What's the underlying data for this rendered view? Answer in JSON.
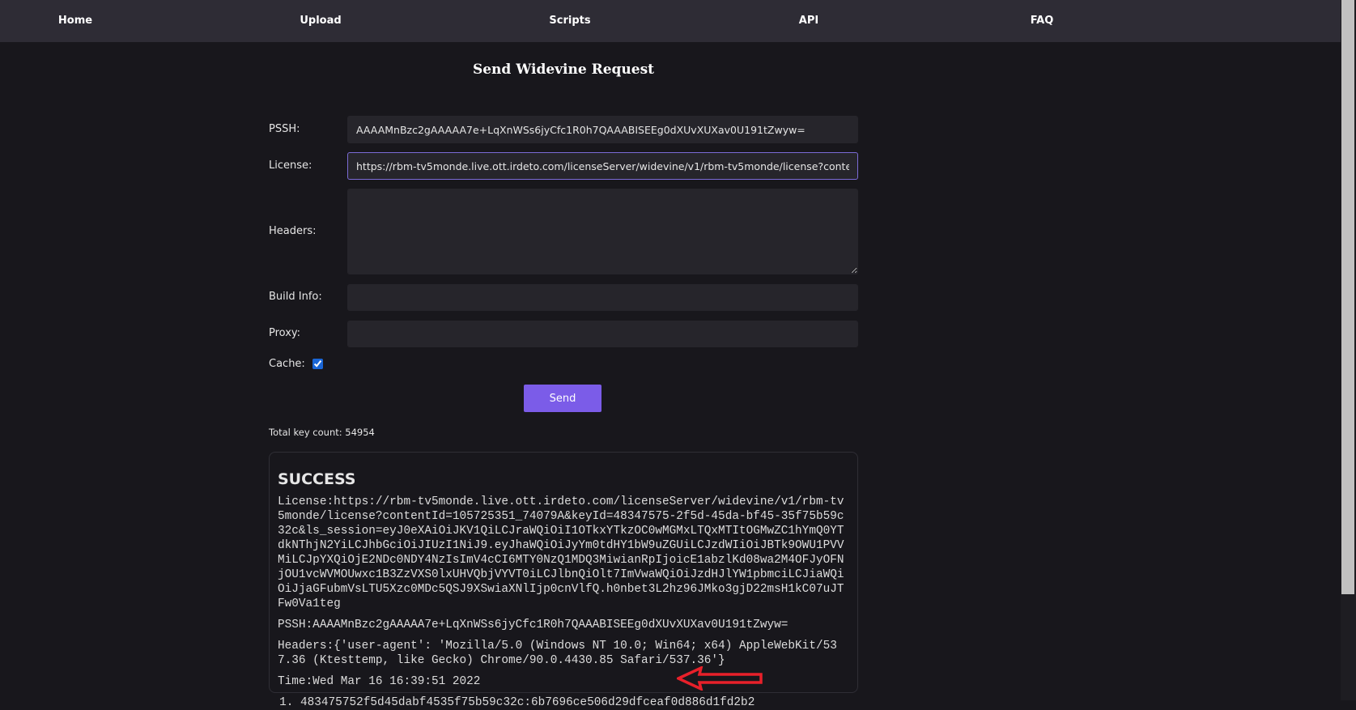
{
  "nav": {
    "items": [
      {
        "label": "Home"
      },
      {
        "label": "Upload"
      },
      {
        "label": "Scripts"
      },
      {
        "label": "API"
      },
      {
        "label": "FAQ"
      }
    ]
  },
  "page_title": "Send Widevine Request",
  "form": {
    "pssh_label": "PSSH:",
    "pssh_value": "AAAAMnBzc2gAAAAA7e+LqXnWSs6jyCfc1R0h7QAAABISEEg0dXUvXUXav0U191tZwyw=",
    "license_label": "License:",
    "license_value": "https://rbm-tv5monde.live.ott.irdeto.com/licenseServer/widevine/v1/rbm-tv5monde/license?contentId=105725351_74079A&keyId=48347575-2f5d-45da-bf45-35f75b59c32c&ls_session=",
    "headers_label": "Headers:",
    "headers_value": "",
    "build_label": "Build Info:",
    "build_value": "",
    "proxy_label": "Proxy:",
    "proxy_value": "",
    "cache_label": "Cache:",
    "cache_checked": true,
    "send_label": "Send"
  },
  "total_key_count": "Total key count: 54954",
  "result": {
    "status": "SUCCESS",
    "license": "License:https://rbm-tv5monde.live.ott.irdeto.com/licenseServer/widevine/v1/rbm-tv5monde/license?contentId=105725351_74079A&keyId=48347575-2f5d-45da-bf45-35f75b59c32c&ls_session=eyJ0eXAiOiJKV1QiLCJraWQiOiI1OTkxYTkzOC0wMGMxLTQxMTItOGMwZC1hYmQ0YTdkNThjN2YiLCJhbGciOiJIUzI1NiJ9.eyJhaWQiOiJyYm0tdHY1bW9uZGUiLCJzdWIiOiJBTk9OWU1PVVMiLCJpYXQiOjE2NDc0NDY4NzIsImV4cCI6MTY0NzQ1MDQ3MiwianRpIjoicE1abzlKd08wa2M4OFJyOFNjOU1vcWVMOUwxc1B3ZzVXS0lxUHVQbjVYVT0iLCJlbnQiOlt7ImVwaWQiOiJzdHJlYW1pbmciLCJiaWQiOiJjaGFubmVsLTU5Xzc0MDc5QSJ9XSwiaXNlIjp0cnVlfQ.h0nbet3L2hz96JMko3gjD22msH1kC07uJTFw0Va1teg",
    "pssh": "PSSH:AAAAMnBzc2gAAAAA7e+LqXnWSs6jyCfc1R0h7QAAABISEEg0dXUvXUXav0U191tZwyw=",
    "headers": "Headers:{'user-agent': 'Mozilla/5.0 (Windows NT 10.0; Win64; x64) AppleWebKit/537.36 (Ktesttemp, like Gecko) Chrome/90.0.4430.85 Safari/537.36'}",
    "time": "Time:Wed Mar 16 16:39:51 2022",
    "keys": [
      "483475752f5d45dabf4535f75b59c32c:6b7696ce506d29dfceaf0d886d1fd2b2"
    ]
  },
  "colors": {
    "accent": "#7b5ce8",
    "annotation_arrow": "#e8202a"
  }
}
